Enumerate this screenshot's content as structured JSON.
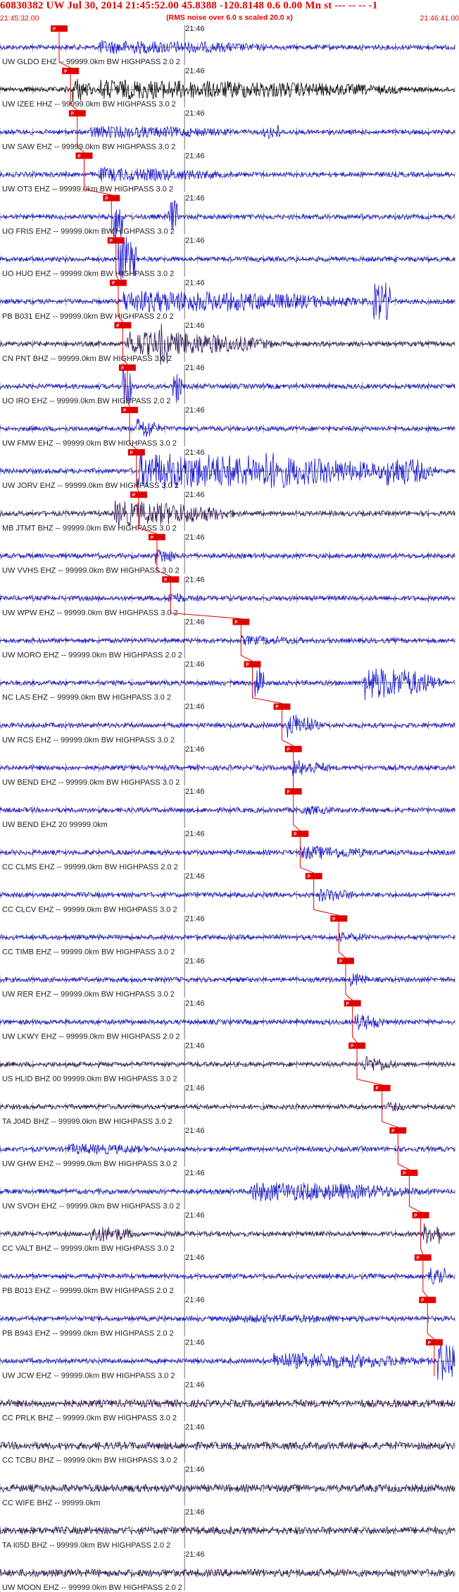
{
  "header": {
    "title": "60830382 UW Jul 30, 2014 21:45:52.00   45.8388 -120.8148  0.6 0.00 Mn st --- -- --  -1",
    "subtitle": "(RMS noise over 6.0 s scaled 20.0 x)",
    "start_time": "21:45:32.00",
    "end_time": "21:46:41.00"
  },
  "colors": {
    "title": "#e00000",
    "trace_blue": "#1010d0",
    "trace_dark": "#2a1050",
    "trace_black": "#000000",
    "pick": "#e00000"
  },
  "chart_data": {
    "type": "line",
    "title": "60830382 UW Jul 30, 2014 21:45:52.00   45.8388 -120.8148  0.6 0.00 Mn st --- -- --  -1",
    "subtitle": "(RMS noise over 6.0 s scaled 20.0 x)",
    "x_range": [
      "21:45:32.00",
      "21:46:41.00"
    ],
    "minute_mark": "21:46",
    "pick_label": "P",
    "grid": "tick marks",
    "traces": [
      {
        "label": "UW GLDO EHZ -- 99999.0km BW  HIGHPASS  2.0  2",
        "color": "blue",
        "pick": 0.13,
        "bursts": [
          [
            0.22,
            0.45,
            0.5
          ]
        ]
      },
      {
        "label": "UW IZEE HHZ -- 99999.0km BW  HIGHPASS  3.0  2",
        "color": "black",
        "pick": 0.155,
        "bursts": [
          [
            0.16,
            0.05,
            0.9
          ],
          [
            0.22,
            0.78,
            0.7
          ]
        ]
      },
      {
        "label": "UW SAW EHZ -- 99999.0km BW  HIGHPASS  3.0  2",
        "color": "blue",
        "pick": 0.17,
        "bursts": [
          [
            0.2,
            0.4,
            0.45
          ],
          [
            0.58,
            0.04,
            0.35
          ]
        ]
      },
      {
        "label": "UW OT3 EHZ -- 99999.0km BW  HIGHPASS  3.0  2",
        "color": "blue",
        "pick": 0.185,
        "bursts": [
          [
            0.22,
            0.35,
            0.5
          ]
        ]
      },
      {
        "label": "UO FRIS EHZ -- 99999.0km BW  HIGHPASS  3.0  2",
        "color": "blue",
        "pick": 0.245,
        "bursts": [
          [
            0.25,
            0.02,
            1.1
          ],
          [
            0.37,
            0.02,
            0.8
          ]
        ]
      },
      {
        "label": "UO HUO EHZ -- 99999.0km BW  HIGHPASS  3.0  2",
        "color": "blue",
        "pick": 0.255,
        "bursts": [
          [
            0.26,
            0.02,
            1.1
          ],
          [
            0.28,
            0.02,
            0.9
          ]
        ]
      },
      {
        "label": "PB B031 EHZ -- 99999.0km BW  HIGHPASS  2.0  2",
        "color": "blue",
        "pick": 0.26,
        "bursts": [
          [
            0.27,
            0.6,
            0.8
          ],
          [
            0.82,
            0.04,
            0.9
          ]
        ]
      },
      {
        "label": "CN PNT BHZ -- 99999.0km BW  HIGHPASS  3.0  2",
        "color": "dark",
        "pick": 0.27,
        "bursts": [
          [
            0.28,
            0.36,
            0.9
          ],
          [
            0.35,
            0.02,
            1.0
          ]
        ]
      },
      {
        "label": "UO IRO EHZ -- 99999.0km BW  HIGHPASS  2.0  2",
        "color": "blue",
        "pick": 0.28,
        "bursts": [
          [
            0.27,
            0.02,
            1.1
          ],
          [
            0.38,
            0.02,
            0.8
          ]
        ]
      },
      {
        "label": "UW FMW EHZ -- 99999.0km BW  HIGHPASS  3.0  2",
        "color": "blue",
        "pick": 0.285,
        "bursts": [
          [
            0.3,
            0.06,
            0.8
          ]
        ]
      },
      {
        "label": "UW JORV EHZ -- 99999.0km BW  HIGHPASS  3.0  2",
        "color": "blue",
        "pick": 0.3,
        "bursts": [
          [
            0.3,
            0.66,
            1.3
          ],
          [
            0.58,
            0.1,
            1.4
          ],
          [
            0.85,
            0.12,
            1.1
          ]
        ]
      },
      {
        "label": "MB JTMT BHZ -- 99999.0km BW  HIGHPASS  3.0  2",
        "color": "dark",
        "pick": 0.305,
        "bursts": [
          [
            0.25,
            0.3,
            0.9
          ]
        ]
      },
      {
        "label": "UW VVHS EHZ -- 99999.0km BW  HIGHPASS  3.0  2",
        "color": "blue",
        "pick": 0.345,
        "bursts": [
          [
            0.34,
            0.06,
            0.6
          ]
        ]
      },
      {
        "label": "UW WPW EHZ -- 99999.0km BW  HIGHPASS  3.0  2",
        "color": "blue",
        "pick": 0.375,
        "bursts": [
          [
            0.37,
            0.05,
            0.5
          ]
        ]
      },
      {
        "label": "UW MORO EHZ -- 99999.0km BW  HIGHPASS  2.0  2",
        "color": "blue",
        "pick": 0.53,
        "bursts": [
          [
            0.53,
            0.2,
            0.35
          ]
        ]
      },
      {
        "label": "NC LAS EHZ -- 99999.0km BW  HIGHPASS  3.0  2",
        "color": "blue",
        "pick": 0.555,
        "bursts": [
          [
            0.56,
            0.02,
            0.9
          ],
          [
            0.8,
            0.19,
            1.2
          ]
        ]
      },
      {
        "label": "UW RCS EHZ -- 99999.0km BW  HIGHPASS  3.0  2",
        "color": "blue",
        "pick": 0.62,
        "bursts": [
          [
            0.63,
            0.08,
            0.9
          ]
        ]
      },
      {
        "label": "UW BEND EHZ -- 99999.0km BW  HIGHPASS  3.0  2",
        "color": "blue",
        "pick": 0.645,
        "bursts": [
          [
            0.64,
            0.1,
            0.6
          ]
        ]
      },
      {
        "label": "UW BEND EHZ 20 99999.0km",
        "color": "blue",
        "pick": 0.645,
        "bursts": [
          [
            0.66,
            0.1,
            0.35
          ]
        ]
      },
      {
        "label": "CC CLMS EHZ -- 99999.0km BW  HIGHPASS  2.0  2",
        "color": "blue",
        "pick": 0.66,
        "bursts": [
          [
            0.66,
            0.2,
            0.5
          ]
        ]
      },
      {
        "label": "CC CLCV EHZ -- 99999.0km BW  HIGHPASS  3.0  2",
        "color": "blue",
        "pick": 0.69,
        "bursts": [
          [
            0.7,
            0.1,
            0.5
          ]
        ]
      },
      {
        "label": "CC TIMB EHZ -- 99999.0km BW  HIGHPASS  3.0  2",
        "color": "blue",
        "pick": 0.745,
        "bursts": [
          [
            0.74,
            0.1,
            0.35
          ]
        ]
      },
      {
        "label": "UW RER EHZ -- 99999.0km BW  HIGHPASS  3.0  2",
        "color": "blue",
        "pick": 0.76,
        "bursts": [
          [
            0.77,
            0.05,
            0.5
          ]
        ]
      },
      {
        "label": "UW LKWY EHZ -- 99999.0km BW  HIGHPASS  2.0  2",
        "color": "blue",
        "pick": 0.775,
        "bursts": [
          [
            0.78,
            0.08,
            0.6
          ]
        ]
      },
      {
        "label": "US HLID BHZ 00 99999.0km BW  HIGHPASS  3.0  2",
        "color": "dark",
        "pick": 0.785,
        "bursts": [
          [
            0.8,
            0.08,
            0.6
          ]
        ]
      },
      {
        "label": "TA J04D BHZ -- 99999.0km BW  HIGHPASS  3.0  2",
        "color": "dark",
        "pick": 0.84,
        "bursts": [
          [
            0.85,
            0.06,
            0.35
          ]
        ]
      },
      {
        "label": "UW GHW EHZ -- 99999.0km BW  HIGHPASS  3.0  2",
        "color": "blue",
        "pick": 0.875,
        "bursts": [
          [
            0.15,
            0.25,
            0.4
          ]
        ]
      },
      {
        "label": "UW SVOH EHZ -- 99999.0km BW  HIGHPASS  3.0  2",
        "color": "blue",
        "pick": 0.9,
        "bursts": [
          [
            0.55,
            0.44,
            0.7
          ]
        ]
      },
      {
        "label": "CC VALT BHZ -- 99999.0km BW  HIGHPASS  3.0  2",
        "color": "dark",
        "pick": 0.925,
        "bursts": [
          [
            0.2,
            0.12,
            0.6
          ],
          [
            0.93,
            0.04,
            0.5
          ]
        ]
      },
      {
        "label": "PB B013 EHZ -- 99999.0km BW  HIGHPASS  2.0  2",
        "color": "blue",
        "pick": 0.93,
        "bursts": [
          [
            0.94,
            0.04,
            0.45
          ]
        ]
      },
      {
        "label": "PB B943 EHZ -- 99999.0km BW  HIGHPASS  2.0  2",
        "color": "blue",
        "pick": 0.94,
        "bursts": [
          [
            0.5,
            0.5,
            0.3
          ]
        ]
      },
      {
        "label": "UW JCW EHZ -- 99999.0km BW  HIGHPASS  3.0  2",
        "color": "blue",
        "pick": 0.955,
        "bursts": [
          [
            0.6,
            0.4,
            0.6
          ],
          [
            0.96,
            0.04,
            1.0
          ]
        ]
      },
      {
        "label": "CC PRLK BHZ -- 99999.0km BW  HIGHPASS  3.0  2",
        "color": "dark",
        "pick": null,
        "bursts": []
      },
      {
        "label": "CC TCBU BHZ -- 99999.0km BW  HIGHPASS  3.0  2",
        "color": "dark",
        "pick": null,
        "bursts": []
      },
      {
        "label": "CC WIFE BHZ -- 99999.0km",
        "color": "dark",
        "pick": null,
        "bursts": []
      },
      {
        "label": "TA I05D BHZ -- 99999.0km BW  HIGHPASS  2.0  2",
        "color": "dark",
        "pick": null,
        "bursts": []
      },
      {
        "label": "UW MOON EHZ -- 99999.0km BW  HIGHPASS  2.0  2",
        "color": "dark",
        "pick": null,
        "bursts": []
      }
    ]
  }
}
